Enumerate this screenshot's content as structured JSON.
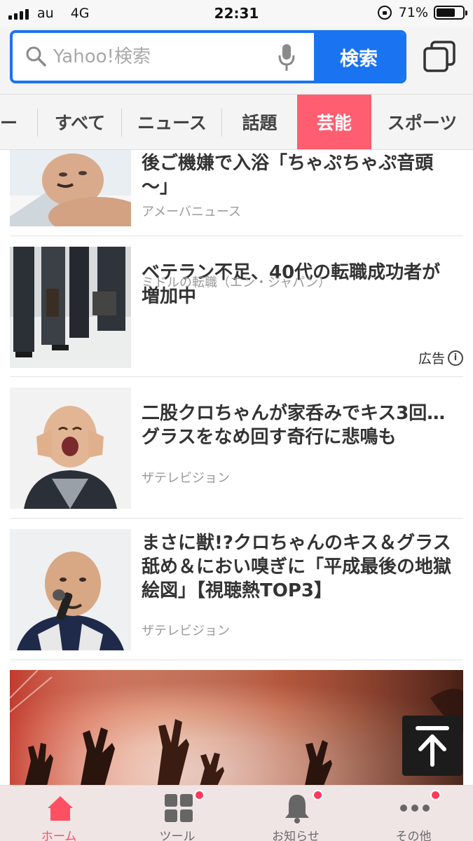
{
  "status_bar": {
    "carrier": "au",
    "network": "4G",
    "time": "22:31",
    "battery": "71%",
    "battery_level": 0.71
  },
  "search": {
    "placeholder": "Yahoo!検索",
    "button_label": "検索"
  },
  "categories": [
    {
      "label": "ー",
      "active": false
    },
    {
      "label": "すべて",
      "active": false
    },
    {
      "label": "ニュース",
      "active": false
    },
    {
      "label": "話題",
      "active": false
    },
    {
      "label": "芸能",
      "active": true
    },
    {
      "label": "スポーツ",
      "active": false
    }
  ],
  "articles": [
    {
      "title_lines": [
        "後ご機嫌で入浴「ちゃぷちゃぷ音頭",
        "〜」"
      ],
      "source": "アメーバニュース",
      "ad": false
    },
    {
      "title_lines": [
        "ベテラン不足、40代の転職成功者が",
        "増加中"
      ],
      "source": "ミドルの転職（エン・ジャパン）",
      "ad": true,
      "ad_label": "広告"
    },
    {
      "title_lines": [
        "二股クロちゃんが家呑みでキス3回…",
        "グラスをなめ回す奇行に悲鳴も"
      ],
      "source": "ザテレビジョン",
      "ad": false
    },
    {
      "title_lines": [
        "まさに獣!?クロちゃんのキス＆グラス",
        "舐め＆におい嗅ぎに「平成最後の地獄",
        "絵図」【視聴熱TOP3】"
      ],
      "source": "ザテレビジョン",
      "ad": false
    }
  ],
  "bottom_nav": [
    {
      "label": "ホーム",
      "icon": "home-icon",
      "active": true,
      "badge": false
    },
    {
      "label": "ツール",
      "icon": "tools-icon",
      "active": false,
      "badge": true
    },
    {
      "label": "お知らせ",
      "icon": "bell-icon",
      "active": false,
      "badge": true
    },
    {
      "label": "その他",
      "icon": "more-icon",
      "active": false,
      "badge": true
    }
  ],
  "colors": {
    "accent_blue": "#1a73f0",
    "active_tab": "#ff5d70",
    "badge_red": "#ff3b5c"
  }
}
